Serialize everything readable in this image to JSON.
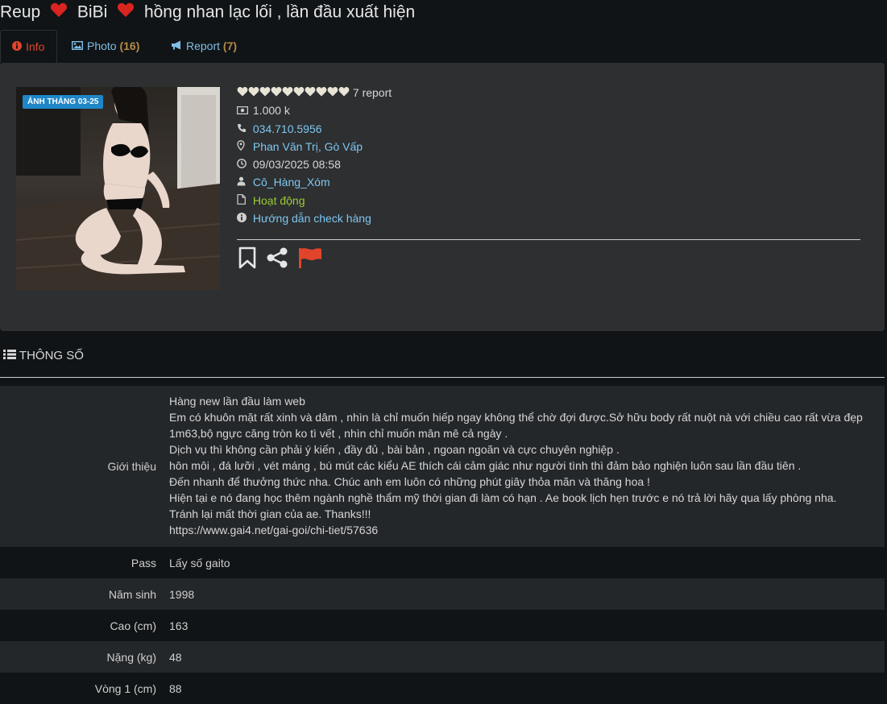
{
  "header": {
    "title_part1": "Reup",
    "title_part2": "BiBi",
    "title_part3": "hồng nhan lạc lối , lần đầu xuất hiện"
  },
  "tabs": [
    {
      "label": "Info",
      "count": ""
    },
    {
      "label": "Photo",
      "count": "(16)"
    },
    {
      "label": "Report",
      "count": "(7)"
    }
  ],
  "profile": {
    "photo_badge": "ẢNH THÁNG 03-25",
    "report_text": "7 report",
    "hearts_count": 10,
    "price": "1.000 k",
    "phone": "034.710.5956",
    "location": "Phan Văn Trị, Gò Vấp",
    "datetime": "09/03/2025 08:58",
    "user": "Cô_Hàng_Xóm",
    "status": "Hoạt động",
    "guide": "Hướng dẫn check hàng"
  },
  "section": {
    "title": "THÔNG SỐ"
  },
  "specs": {
    "intro_label": "Giới thiệu",
    "intro_lines": [
      "Hàng new lần đầu làm web",
      "Em có khuôn mặt rất xinh và dâm , nhìn là chỉ muốn hiếp ngay không thể chờ đợi được.Sở hữu body rất nuột nà với chiều cao rất vừa đẹp",
      "1m63,bộ ngực căng tròn ko tì vết , nhìn chỉ muốn mân mê cả ngày .",
      "Dịch vụ thì không cần phải ý kiến , đầy đủ , bài bản , ngoan ngoãn và cực chuyên nghiệp .",
      "hôn môi , đá lưỡi , vét máng , bú mút các kiểu AE thích cái cảm giác như người tình thì đảm bảo nghiện luôn sau lần đầu tiên .",
      "Đến nhanh để thưởng thức nha. Chúc anh em luôn có những phút giây thỏa mãn và thăng hoa !",
      "Hiện tại e nó đang học thêm ngành nghề thẩm mỹ thời gian đi làm có hạn . Ae book lịch hẹn trước e nó trả lời hãy qua lấy phòng nha.",
      "Tránh lại mất thời gian của ae. Thanks!!!",
      "https://www.gai4.net/gai-goi/chi-tiet/57636"
    ],
    "pass_label": "Pass",
    "pass_value": "Lấy số gaito",
    "year_label": "Năm sinh",
    "year_value": "1998",
    "height_label": "Cao (cm)",
    "height_value": "163",
    "weight_label": "Nặng (kg)",
    "weight_value": "48",
    "bust_label": "Vòng 1 (cm)",
    "bust_value": "88"
  },
  "colors": {
    "background": "#101416",
    "panel": "#2d2f31",
    "link": "#7fc7f0",
    "heart_red": "#d9241f",
    "status_green": "#9acd32",
    "flag_red": "#e0452c",
    "count_gold": "#b58a45"
  },
  "icons": [
    "heart-icon",
    "info-icon",
    "photo-icon",
    "megaphone-icon",
    "money-icon",
    "phone-icon",
    "map-marker-icon",
    "clock-icon",
    "user-icon",
    "file-icon",
    "bookmark-icon",
    "share-icon",
    "flag-icon",
    "list-icon"
  ]
}
